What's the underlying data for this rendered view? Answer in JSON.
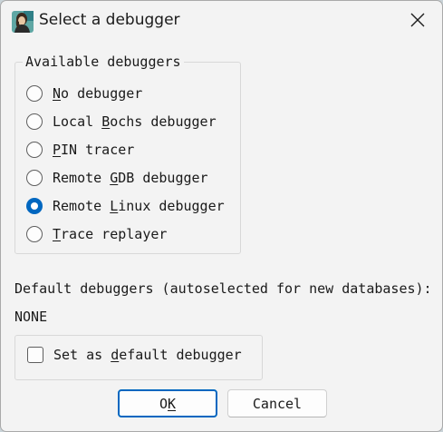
{
  "window": {
    "title": "Select a debugger",
    "icon": "ida-app-icon",
    "close_icon": "close-icon"
  },
  "debuggers_group": {
    "title": "Available debuggers",
    "selected": "Remote Linux debugger",
    "options": [
      {
        "pre": "",
        "key": "N",
        "post": "o debugger",
        "checked": false
      },
      {
        "pre": "Local ",
        "key": "B",
        "post": "ochs debugger",
        "checked": false
      },
      {
        "pre": "",
        "key": "P",
        "post": "IN tracer",
        "checked": false
      },
      {
        "pre": "Remote ",
        "key": "G",
        "post": "DB debugger",
        "checked": false
      },
      {
        "pre": "Remote ",
        "key": "L",
        "post": "inux debugger",
        "checked": true
      },
      {
        "pre": "",
        "key": "T",
        "post": "race replayer",
        "checked": false
      }
    ]
  },
  "defaults": {
    "label": "Default debuggers (autoselected for new databases):",
    "value": "NONE"
  },
  "set_default": {
    "pre": "Set as ",
    "key": "d",
    "post": "efault debugger",
    "checked": false
  },
  "buttons": {
    "ok": {
      "pre": "O",
      "key": "K",
      "post": ""
    },
    "cancel": "Cancel"
  },
  "colors": {
    "accent": "#0067c0",
    "dialog_background": "#f3f3f3"
  }
}
